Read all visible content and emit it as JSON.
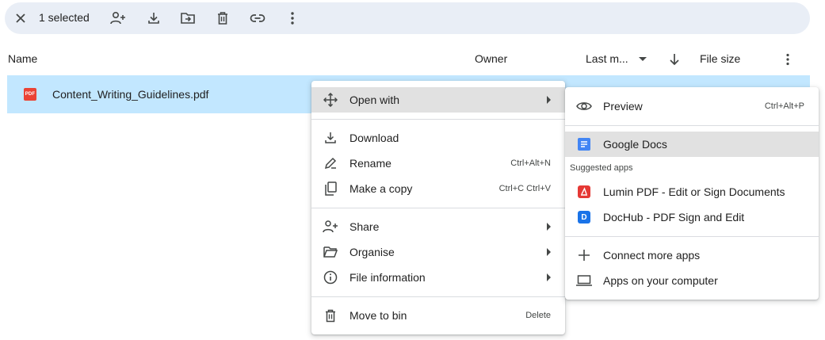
{
  "toolbar": {
    "selected_count": "1 selected",
    "icons": [
      "close-icon",
      "share-person-icon",
      "download-icon",
      "move-folder-icon",
      "trash-icon",
      "link-icon",
      "more-vert-icon"
    ]
  },
  "header": {
    "name": "Name",
    "owner": "Owner",
    "last_modified": "Last m...",
    "file_size": "File size"
  },
  "file": {
    "badge": "PDF",
    "name": "Content_Writing_Guidelines.pdf"
  },
  "context_menu": {
    "open_with": "Open with",
    "download": "Download",
    "rename": "Rename",
    "rename_shortcut": "Ctrl+Alt+N",
    "make_copy": "Make a copy",
    "make_copy_shortcut": "Ctrl+C Ctrl+V",
    "share": "Share",
    "organise": "Organise",
    "file_information": "File information",
    "move_to_bin": "Move to bin",
    "move_to_bin_shortcut": "Delete"
  },
  "open_with_menu": {
    "preview": "Preview",
    "preview_shortcut": "Ctrl+Alt+P",
    "google_docs": "Google Docs",
    "suggested_apps": "Suggested apps",
    "lumin": "Lumin PDF - Edit or Sign Documents",
    "dochub": "DocHub - PDF Sign and Edit",
    "dochub_letter": "D",
    "connect_more": "Connect more apps",
    "apps_on_computer": "Apps on your computer"
  },
  "colors": {
    "selection_bar": "#e9eef6",
    "selected_row": "#c2e7ff",
    "menu_highlight": "#e1e1e1",
    "pdf_red": "#ea4335",
    "docs_blue": "#4285f4",
    "lumin_red": "#e53935",
    "dochub_blue": "#1a73e8"
  }
}
